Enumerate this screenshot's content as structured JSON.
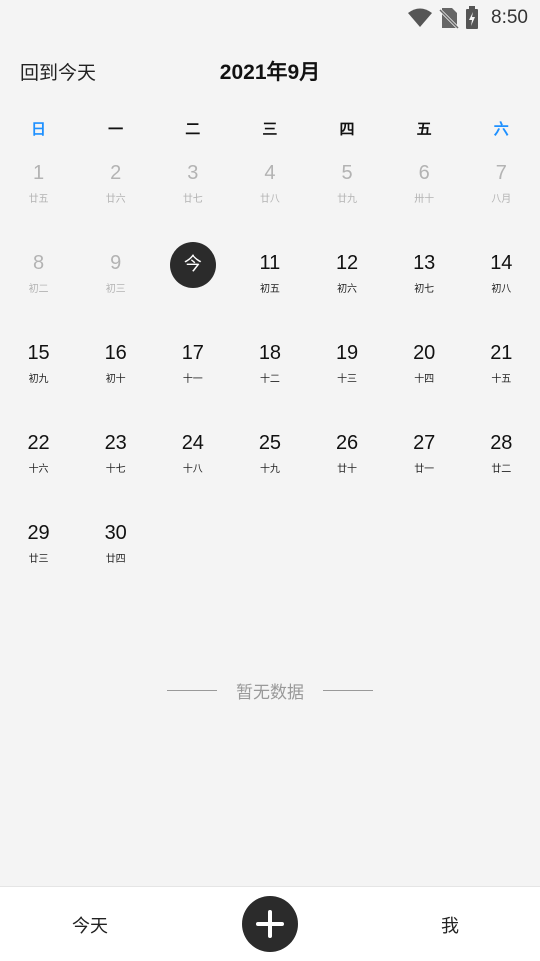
{
  "status_bar": {
    "time": "8:50",
    "icons": [
      "wifi-icon",
      "no-sim-icon",
      "battery-charging-icon"
    ]
  },
  "header": {
    "back_today_label": "回到今天",
    "month_title": "2021年9月"
  },
  "weekdays": [
    "日",
    "一",
    "二",
    "三",
    "四",
    "五",
    "六"
  ],
  "weeks": [
    [
      {
        "num": "",
        "lunar": "",
        "state": "empty"
      },
      {
        "num": "",
        "lunar": "",
        "state": "empty"
      },
      {
        "num": "",
        "lunar": "",
        "state": "empty"
      },
      {
        "num": "1",
        "lunar": "廿五",
        "state": "past"
      },
      {
        "num": "2",
        "lunar": "廿六",
        "state": "past"
      },
      {
        "num": "3",
        "lunar": "廿七",
        "state": "past"
      },
      {
        "num": "4",
        "lunar": "廿八",
        "state": "past"
      }
    ],
    [
      {
        "num": "5",
        "lunar": "廿九",
        "state": "past"
      },
      {
        "num": "6",
        "lunar": "卅十",
        "state": "past"
      },
      {
        "num": "7",
        "lunar": "八月",
        "state": "past"
      },
      {
        "num": "8",
        "lunar": "初二",
        "state": "past"
      },
      {
        "num": "9",
        "lunar": "初三",
        "state": "past"
      },
      {
        "num": "10",
        "lunar": "",
        "state": "today",
        "today_label": "今"
      },
      {
        "num": "11",
        "lunar": "初五",
        "state": "normal"
      }
    ],
    [
      {
        "num": "12",
        "lunar": "初六",
        "state": "normal"
      },
      {
        "num": "13",
        "lunar": "初七",
        "state": "normal"
      },
      {
        "num": "14",
        "lunar": "初八",
        "state": "normal"
      },
      {
        "num": "15",
        "lunar": "初九",
        "state": "normal"
      },
      {
        "num": "16",
        "lunar": "初十",
        "state": "normal"
      },
      {
        "num": "17",
        "lunar": "十一",
        "state": "normal"
      },
      {
        "num": "18",
        "lunar": "十二",
        "state": "normal"
      }
    ],
    [
      {
        "num": "19",
        "lunar": "十三",
        "state": "normal"
      },
      {
        "num": "20",
        "lunar": "十四",
        "state": "normal"
      },
      {
        "num": "21",
        "lunar": "十五",
        "state": "normal"
      },
      {
        "num": "22",
        "lunar": "十六",
        "state": "normal"
      },
      {
        "num": "23",
        "lunar": "十七",
        "state": "normal"
      },
      {
        "num": "24",
        "lunar": "十八",
        "state": "normal"
      },
      {
        "num": "25",
        "lunar": "十九",
        "state": "normal"
      }
    ],
    [
      {
        "num": "26",
        "lunar": "廿十",
        "state": "normal"
      },
      {
        "num": "27",
        "lunar": "廿一",
        "state": "normal"
      },
      {
        "num": "28",
        "lunar": "廿二",
        "state": "normal"
      },
      {
        "num": "29",
        "lunar": "廿三",
        "state": "normal"
      },
      {
        "num": "30",
        "lunar": "廿四",
        "state": "normal"
      },
      {
        "num": "",
        "lunar": "",
        "state": "empty"
      },
      {
        "num": "",
        "lunar": "",
        "state": "empty"
      }
    ]
  ],
  "empty_state": {
    "text": "暂无数据"
  },
  "bottom_nav": {
    "today_label": "今天",
    "add_icon": "plus-icon",
    "me_label": "我"
  },
  "colors": {
    "weekend": "#1e90ff",
    "today_circle": "#2b2b2b",
    "past": "#b3b3b3",
    "background": "#f4f4f4"
  }
}
